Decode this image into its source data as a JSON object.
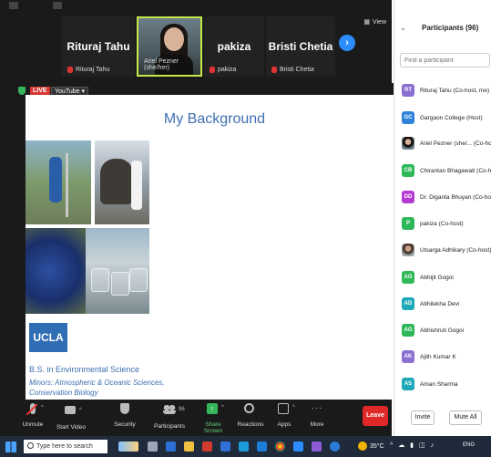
{
  "colors": {
    "accent_blue": "#2d8cff",
    "slide_text_blue": "#3d6fb0",
    "leave_red": "#e02828",
    "live_red": "#d53a33",
    "share_green": "#35b65a",
    "speaker_border": "#c6e64a",
    "dark_bg": "#1a1a1a"
  },
  "view_label": "View",
  "tiles": [
    {
      "big": "Rituraj Tahu",
      "small": "Rituraj Tahu",
      "muted": true
    },
    {
      "big": "",
      "small": "Ariel Pezner (she/her)",
      "muted": false,
      "active_speaker": true
    },
    {
      "big": "pakiza",
      "small": "pakiza",
      "muted": true
    },
    {
      "big": "Bristi Chetia",
      "small": "Bristi Chetia",
      "muted": true
    }
  ],
  "share_bar": {
    "live": "LIVE",
    "platform": "YouTube ▾"
  },
  "slide": {
    "title": "My Background",
    "logo": "UCLA",
    "degree": "B.S. in Environmental Science",
    "minors": "Minors: Atmospheric & Oceanic Sciences, Conservation Biology"
  },
  "toolbar": {
    "unmute": "Unmute",
    "start_video": "Start Video",
    "security": "Security",
    "participants": "Participants",
    "participants_count": "96",
    "share_screen": "Share Screen",
    "reactions": "Reactions",
    "apps": "Apps",
    "more": "More",
    "leave": "Leave"
  },
  "panel": {
    "title": "Participants (96)",
    "search_placeholder": "Find a participant",
    "participants": [
      {
        "initials": "RT",
        "name": "Rituraj Tahu (Co-host, me)",
        "color": "#8a6fd1"
      },
      {
        "initials": "GC",
        "name": "Gargaon College (Host)",
        "color": "#2f84d9"
      },
      {
        "initials": "",
        "name": "Ariel Pezner (she/... (Co-host)",
        "color": "",
        "photo": true
      },
      {
        "initials": "CB",
        "name": "Chirantan Bhagawati (Co-host)",
        "color": "#2fb85a"
      },
      {
        "initials": "DD",
        "name": "Dr. Diganta Bhuyan (Co-host)",
        "color": "#b53ad1"
      },
      {
        "initials": "P",
        "name": "pakiza (Co-host)",
        "color": "#2fb85a"
      },
      {
        "initials": "",
        "name": "Utsarga Adhikary (Co-host)",
        "color": "",
        "photo": true
      },
      {
        "initials": "AG",
        "name": "Abhijit Gogoi",
        "color": "#2fb85a"
      },
      {
        "initials": "AD",
        "name": "Abhilekha Devi",
        "color": "#1fa9b8"
      },
      {
        "initials": "AG",
        "name": "Abhishruti Gogoi",
        "color": "#2fb85a"
      },
      {
        "initials": "AK",
        "name": "Ajith Kumar K",
        "color": "#8a6fd1"
      },
      {
        "initials": "AS",
        "name": "Aman Sharma",
        "color": "#1fa9b8"
      }
    ],
    "invite": "Invite",
    "mute_all": "Mute All"
  },
  "taskbar": {
    "search_placeholder": "Type here to search",
    "temperature": "35°C",
    "language": "ENG"
  }
}
